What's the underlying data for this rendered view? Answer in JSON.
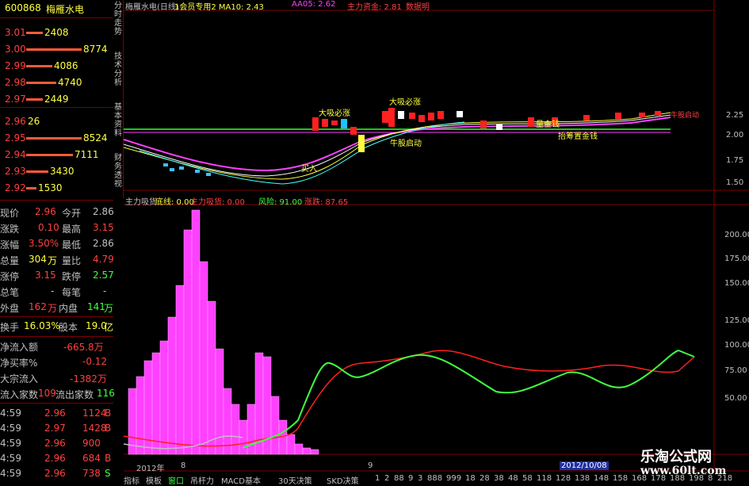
{
  "stock": {
    "code": "600868",
    "name": "梅雁水电"
  },
  "asks": [
    {
      "price": "3.01",
      "vol": "2408",
      "bar": 0.3
    },
    {
      "price": "3.00",
      "vol": "8774",
      "bar": 1.0
    },
    {
      "price": "2.99",
      "vol": "4086",
      "bar": 0.47
    },
    {
      "price": "2.98",
      "vol": "4740",
      "bar": 0.54
    },
    {
      "price": "2.97",
      "vol": "2449",
      "bar": 0.3
    }
  ],
  "bids": [
    {
      "price": "2.96",
      "vol": "26",
      "bar": 0.0
    },
    {
      "price": "2.95",
      "vol": "8524",
      "bar": 1.0
    },
    {
      "price": "2.94",
      "vol": "7111",
      "bar": 0.84
    },
    {
      "price": "2.93",
      "vol": "3430",
      "bar": 0.4
    },
    {
      "price": "2.92",
      "vol": "1530",
      "bar": 0.18
    }
  ],
  "quote": {
    "xianjia_l": "现价",
    "xianjia_v": "2.96",
    "jinkai_l": "今开",
    "jinkai_v": "2.86",
    "zhangdie_l": "涨跌",
    "zhangdie_v": "0.10",
    "zuigao_l": "最高",
    "zuigao_v": "3.15",
    "zhangfu_l": "涨幅",
    "zhangfu_v": "3.50%",
    "zuidi_l": "最低",
    "zuidi_v": "2.86",
    "zongliang_l": "总量",
    "zongliang_v": "304",
    "zongliang_u": "万",
    "liangbi_l": "量比",
    "liangbi_v": "4.79",
    "zhangting_l": "涨停",
    "zhangting_v": "3.15",
    "dieting_l": "跌停",
    "dieting_v": "2.57",
    "zongbi_l": "总笔",
    "zongbi_v": "-",
    "meibi_l": "每笔",
    "meibi_v": "-",
    "waipan_l": "外盘",
    "waipan_v": "162",
    "waipan_u": "万",
    "neipan_l": "内盘",
    "neipan_v": "141",
    "neipan_u": "万",
    "huanshou_l": "换手",
    "huanshou_v": "16.03%",
    "guben_l": "股本",
    "guben_v": "19.0",
    "guben_u": "亿",
    "jingliuru_l": "净流入额",
    "jingliuru_v": "-665.8万",
    "jingmai_l": "净买率%",
    "jingmai_v": "-0.12",
    "dazong_l": "大宗流入",
    "dazong_v": "-1382万",
    "liuru_l": "流入家数",
    "liuru_v": "109",
    "liuchu_l": "流出家数",
    "liuchu_v": "116"
  },
  "ticks": [
    {
      "t": "4:59",
      "p": "2.96",
      "v": "1124",
      "s": "B"
    },
    {
      "t": "4:59",
      "p": "2.97",
      "v": "1428",
      "s": "B"
    },
    {
      "t": "4:59",
      "p": "2.96",
      "v": "900",
      "s": ""
    },
    {
      "t": "4:59",
      "p": "2.96",
      "v": "684",
      "s": "B"
    },
    {
      "t": "4:59",
      "p": "2.96",
      "v": "738",
      "s": "S"
    }
  ],
  "vtabs": [
    "分时走势",
    "技术分析",
    "基本资料",
    "财务透视"
  ],
  "top_bar": {
    "title": "梅雁水电(日线)",
    "indicator": "1会员专用2 MA10: 2.43",
    "aa05": "AA05: 2.62",
    "zhuli": "主力资金: 2.81",
    "extra": "数据明"
  },
  "annotations": {
    "daji1": "大吸必涨",
    "daji2": "大吸必涨",
    "niugu": "牛股启动",
    "daoliang": "量金钱",
    "tuodi": "抬筹置金钱",
    "mai": "买入",
    "daji3": "牛股启动"
  },
  "price_axis": [
    "2.25",
    "2.00",
    "1.75",
    "1.50"
  ],
  "sub_title": {
    "name": "主力吸货",
    "dijian": "底线: 0.00",
    "zhuli": "主力吸货: 0.00",
    "fengxian": "风险: 91.00",
    "zhangdie": "涨跌: 87.65"
  },
  "sub_axis": [
    "200.00",
    "175.00",
    "150.00",
    "125.00",
    "100.00",
    "75.00",
    "50.00"
  ],
  "time_axis": {
    "year": "2012年",
    "m8": "8",
    "m9": "9",
    "date": "2012/10/08"
  },
  "bottom_tabs": [
    "指标",
    "模板",
    "窗口",
    "吊杆力",
    "MACD基本",
    "30天决策",
    "SKD决策",
    "1",
    "2",
    "88",
    "9",
    "3",
    "888",
    "999",
    "18",
    "28",
    "38",
    "48",
    "58",
    "118",
    "128",
    "138",
    "148",
    "158",
    "168",
    "178",
    "188",
    "198",
    "8",
    "218"
  ],
  "watermark": {
    "line1": "乐淘公式网",
    "line2": "www.60lt.com"
  },
  "colors": {
    "red": "#ff4040",
    "yellow": "#ffff40",
    "green": "#40ff40",
    "magenta": "#ff40ff",
    "cyan": "#40ffff"
  }
}
